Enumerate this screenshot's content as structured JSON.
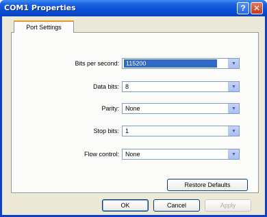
{
  "window": {
    "title": "COM1 Properties",
    "help_glyph": "?",
    "close_glyph": "✕"
  },
  "tabs": [
    {
      "label": "Port Settings",
      "active": true
    }
  ],
  "fields": [
    {
      "label": "Bits per second:",
      "value": "115200",
      "selected": true
    },
    {
      "label": "Data bits:",
      "value": "8"
    },
    {
      "label": "Parity:",
      "value": "None"
    },
    {
      "label": "Stop bits:",
      "value": "1"
    },
    {
      "label": "Flow control:",
      "value": "None"
    }
  ],
  "dropdown_glyph": "▼",
  "buttons": {
    "restore_defaults": "Restore Defaults",
    "ok": "OK",
    "cancel": "Cancel",
    "apply": "Apply"
  },
  "colors": {
    "titlebar": "#0a4fd8",
    "selection": "#316ac5",
    "tab_accent": "#e69a26"
  }
}
